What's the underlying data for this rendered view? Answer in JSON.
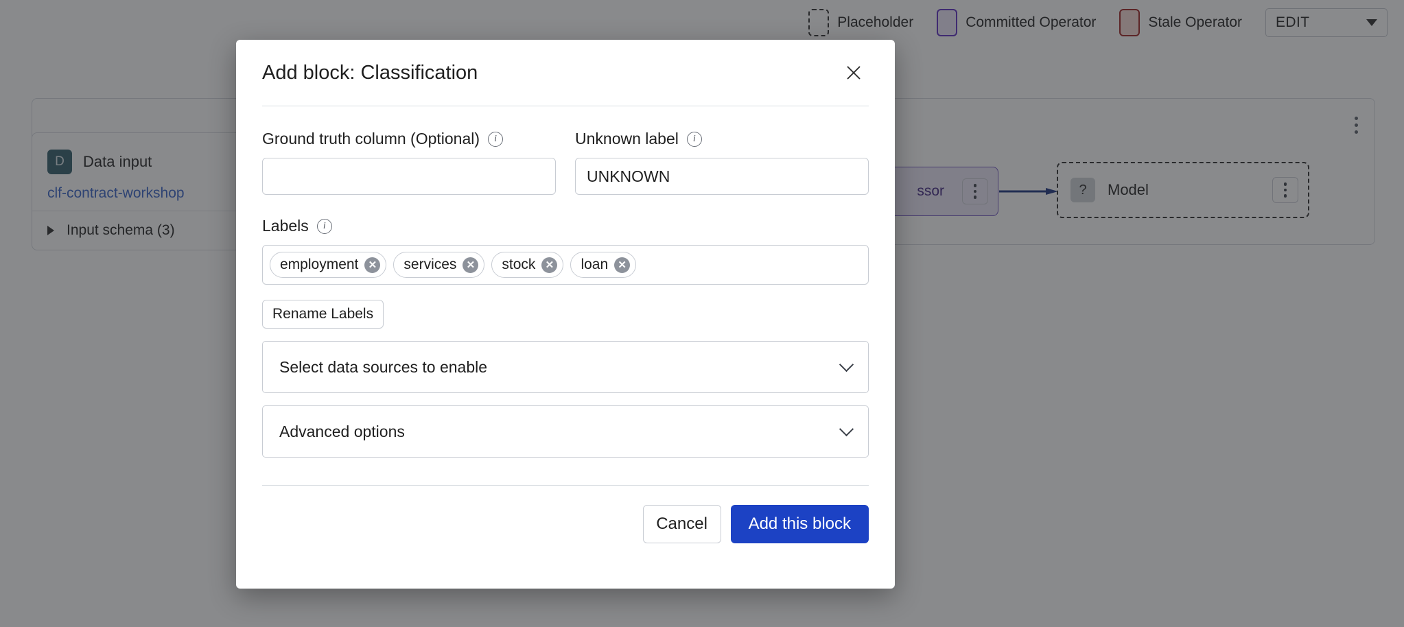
{
  "background": {
    "legend": {
      "items": [
        {
          "label": "Placeholder",
          "swatch": "placeholder",
          "color": "#2b2b2b"
        },
        {
          "label": "Committed Operator",
          "swatch": "committed",
          "color": "#5b2bc4"
        },
        {
          "label": "Stale Operator",
          "swatch": "stale",
          "color": "#9c2020"
        }
      ],
      "edit_select": {
        "value": "EDIT"
      }
    },
    "nodes": {
      "data_input": {
        "badge": "D",
        "title": "Data input",
        "dataset": "clf-contract-workshop",
        "schema_row": "Input schema (3)"
      },
      "operator": {
        "partial_label": "ssor"
      },
      "model": {
        "badge": "?",
        "title": "Model"
      }
    }
  },
  "modal": {
    "title": "Add block: Classification",
    "close_icon": "close-icon",
    "fields": {
      "ground_truth": {
        "label": "Ground truth column (Optional)",
        "value": "",
        "placeholder": ""
      },
      "unknown_label": {
        "label": "Unknown label",
        "value": "UNKNOWN",
        "placeholder": ""
      },
      "labels": {
        "label": "Labels",
        "chips": [
          "employment",
          "services",
          "stock",
          "loan"
        ],
        "remove_glyph": "✕"
      }
    },
    "rename_labels_button": "Rename Labels",
    "accordions": [
      {
        "title": "Select data sources to enable"
      },
      {
        "title": "Advanced options"
      }
    ],
    "footer": {
      "cancel_label": "Cancel",
      "submit_label": "Add this block",
      "primary_color": "#1c42c4"
    }
  }
}
